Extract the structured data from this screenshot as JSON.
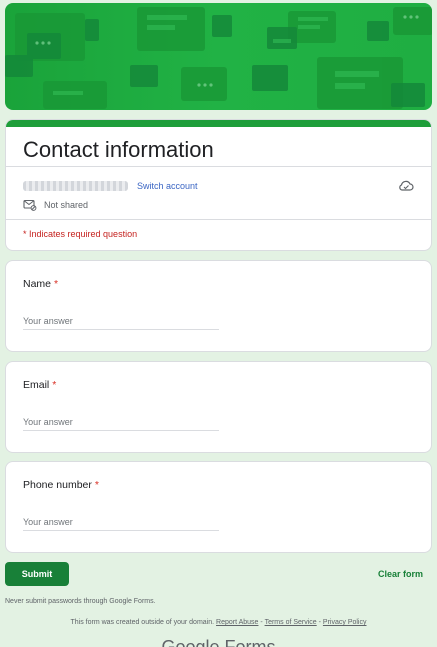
{
  "form": {
    "title": "Contact information",
    "account": {
      "switch_label": "Switch account",
      "not_shared_label": "Not shared"
    },
    "required_note": "* Indicates required question",
    "questions": [
      {
        "label": "Name",
        "required_mark": "*",
        "placeholder": "Your answer"
      },
      {
        "label": "Email",
        "required_mark": "*",
        "placeholder": "Your answer"
      },
      {
        "label": "Phone number",
        "required_mark": "*",
        "placeholder": "Your answer"
      }
    ],
    "submit_label": "Submit",
    "clear_label": "Clear form"
  },
  "footer": {
    "warning": "Never submit passwords through Google Forms.",
    "created_note": "This form was created outside of your domain.",
    "separator": " - ",
    "report_abuse": "Report Abuse",
    "terms": "Terms of Service",
    "privacy": "Privacy Policy",
    "brand": "Google Forms"
  },
  "colors": {
    "accent": "#188038",
    "banner": "#21b245",
    "required": "#d93025",
    "page_bg": "#e3f2e3"
  },
  "icons": {
    "cloud": "cloud-sync-icon",
    "mail": "mail-not-shared-icon"
  }
}
